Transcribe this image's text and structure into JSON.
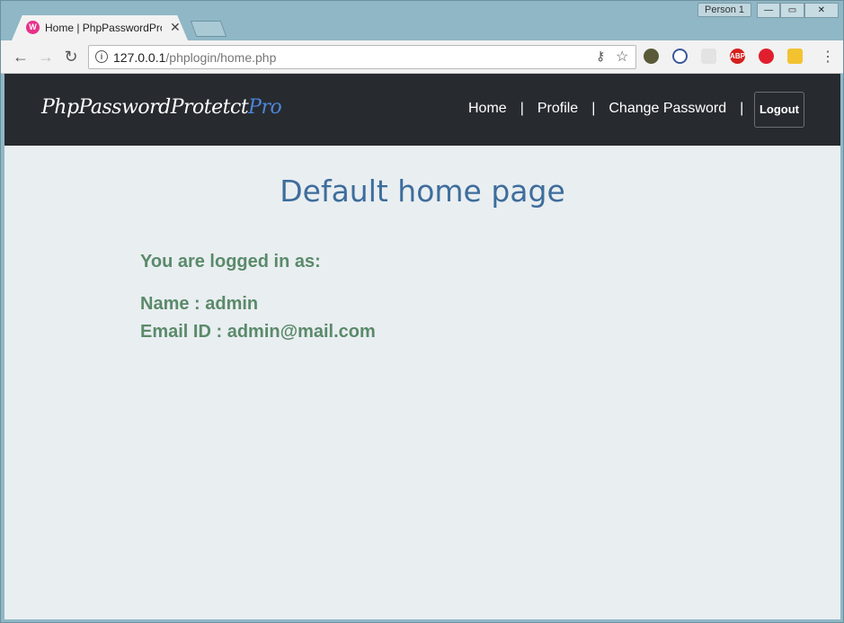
{
  "browser": {
    "tab_title": "Home | PhpPasswordPro",
    "tab_favicon": "W",
    "profile_label": "Person 1",
    "url_host": "127.0.0.1",
    "url_path": "/phplogin/home.php",
    "window_min": "—",
    "window_restore": "▭",
    "window_close": "✕",
    "extensions": [
      {
        "name": "privacy-badger-icon",
        "color": "#5a5a3a"
      },
      {
        "name": "block-icon",
        "color": "#3b5998"
      },
      {
        "name": "shield-icon",
        "color": "#cccccc"
      },
      {
        "name": "adblock-plus-icon",
        "label": "ABP",
        "color": "#d4201e"
      },
      {
        "name": "opera-icon",
        "color": "#e01e2e"
      },
      {
        "name": "folder-icon",
        "color": "#f2c230"
      }
    ]
  },
  "navbar": {
    "brand_main": "PhpPasswordProtetct",
    "brand_pro": "Pro",
    "links": [
      "Home",
      "Profile",
      "Change Password"
    ],
    "separator": "|",
    "logout_label": "Logout"
  },
  "main": {
    "heading": "Default home page",
    "logged_in_label": "You are logged in as:",
    "name_line": "Name : admin",
    "email_line": "Email ID : admin@mail.com"
  }
}
